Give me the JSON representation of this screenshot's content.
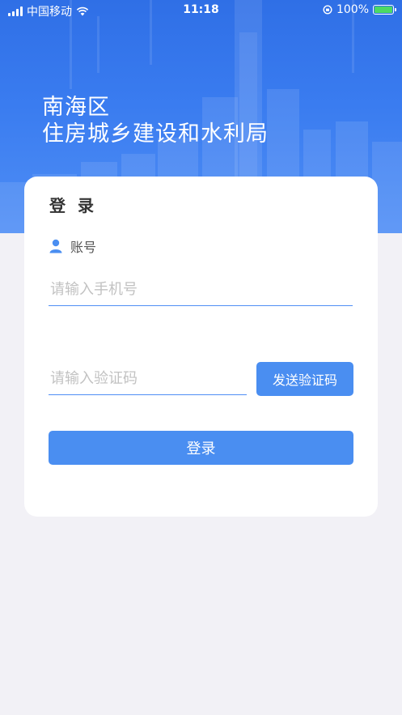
{
  "status_bar": {
    "carrier": "中国移动",
    "time": "11:18",
    "battery_text": "100%",
    "battery_level": 1.0,
    "charging_color": "#4cd964"
  },
  "hero": {
    "line1": "南海区",
    "line2": "住房城乡建设和水利局",
    "colors": {
      "top": "#2f6fe6",
      "bottom": "#4f8ef5"
    }
  },
  "login": {
    "title": "登 录",
    "account_label": "账号",
    "account_icon": "user-icon",
    "phone_placeholder": "请输入手机号",
    "code_placeholder": "请输入验证码",
    "send_code_label": "发送验证码",
    "submit_label": "登录",
    "accent": "#4a8ef1"
  }
}
